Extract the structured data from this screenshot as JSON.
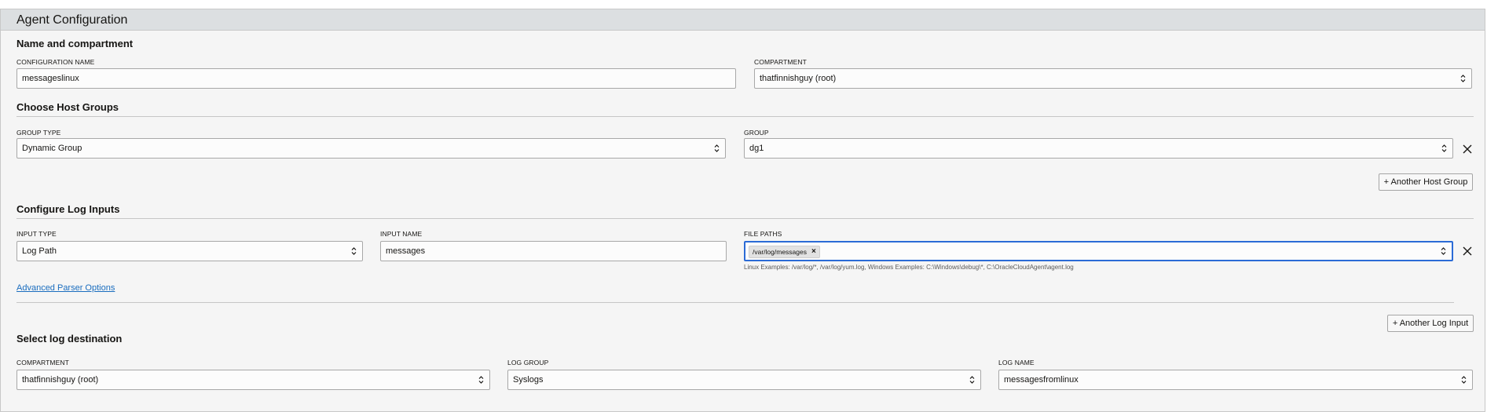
{
  "panel": {
    "title": "Agent Configuration"
  },
  "name_section": {
    "title": "Name and compartment",
    "config_name_label": "CONFIGURATION NAME",
    "config_name_value": "messageslinux",
    "compartment_label": "COMPARTMENT",
    "compartment_value": "thatfinnishguy (root)"
  },
  "host_groups": {
    "title": "Choose Host Groups",
    "group_type_label": "GROUP TYPE",
    "group_type_value": "Dynamic Group",
    "group_label": "GROUP",
    "group_value": "dg1",
    "add_button": "+ Another Host Group"
  },
  "log_inputs": {
    "title": "Configure Log Inputs",
    "input_type_label": "INPUT TYPE",
    "input_type_value": "Log Path",
    "input_name_label": "INPUT NAME",
    "input_name_value": "messages",
    "file_paths_label": "FILE PATHS",
    "file_paths_chip": "/var/log/messages",
    "file_paths_chip_remove": "×",
    "file_paths_hint": "Linux Examples: /var/log/*, /var/log/yum.log,  Windows Examples: C:\\Windows\\debug\\*, C:\\OracleCloudAgent\\agent.log",
    "advanced_link": "Advanced Parser Options",
    "add_button": "+ Another Log Input"
  },
  "destination": {
    "title": "Select log destination",
    "compartment_label": "COMPARTMENT",
    "compartment_value": "thatfinnishguy (root)",
    "log_group_label": "LOG GROUP",
    "log_group_value": "Syslogs",
    "log_name_label": "LOG NAME",
    "log_name_value": "messagesfromlinux"
  },
  "icons": {
    "select_arrows": "chevron-up-down-icon",
    "remove": "close-icon",
    "chip_remove": "close-small-icon"
  }
}
